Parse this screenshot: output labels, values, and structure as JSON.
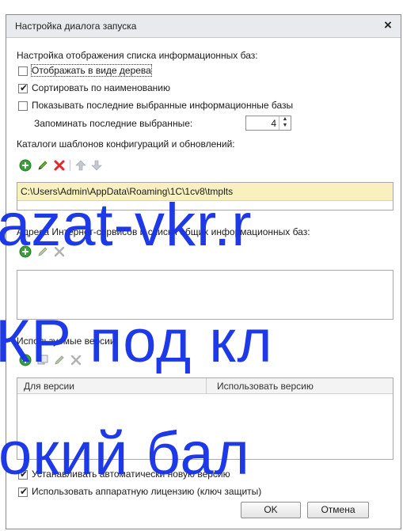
{
  "dialog": {
    "title": "Настройка диалога запуска",
    "close_symbol": "×"
  },
  "infobase_display": {
    "section_label": "Настройка отображения списка информационных баз:",
    "show_tree": {
      "label": "Отображать в виде дерева",
      "checked": false
    },
    "sort_by_name": {
      "label": "Сортировать по наименованию",
      "checked": true
    },
    "show_recent": {
      "label": "Показывать последние выбранные информационные базы",
      "checked": false
    },
    "remember_recent": {
      "label": "Запоминать последние выбранные:",
      "value": "4"
    }
  },
  "templates": {
    "section_label": "Каталоги шаблонов конфигураций и обновлений:",
    "toolbar_icons": [
      "add-icon",
      "edit-icon",
      "delete-icon",
      "move-up-icon",
      "move-down-icon"
    ],
    "paths": [
      "C:\\Users\\Admin\\AppData\\Roaming\\1C\\1cv8\\tmplts"
    ]
  },
  "internet_services": {
    "section_label": "Адреса Интернет-сервисов и списки общих информационных баз:",
    "toolbar_icons": [
      "add-icon",
      "edit-icon",
      "delete-icon"
    ]
  },
  "versions": {
    "section_label": "Используемые версии:",
    "toolbar_icons": [
      "add-icon",
      "copy-icon",
      "edit-icon",
      "delete-icon"
    ],
    "columns": [
      "Для версии",
      "Использовать версию"
    ]
  },
  "options": {
    "auto_install": {
      "label": "Устанавливать автоматически новую версию",
      "checked": true
    },
    "hardware_license": {
      "label": "Использовать аппаратную лицензию (ключ защиты)",
      "checked": true
    }
  },
  "buttons": {
    "ok": "OK",
    "cancel": "Отмена"
  },
  "watermark": {
    "line1": "azat-vkr.r",
    "line2": "КР под кл",
    "line3": "окий бал"
  },
  "colors": {
    "watermark": "#1733e8",
    "selected_row": "#f8f1bf",
    "titlebar": "#e8eaed"
  }
}
